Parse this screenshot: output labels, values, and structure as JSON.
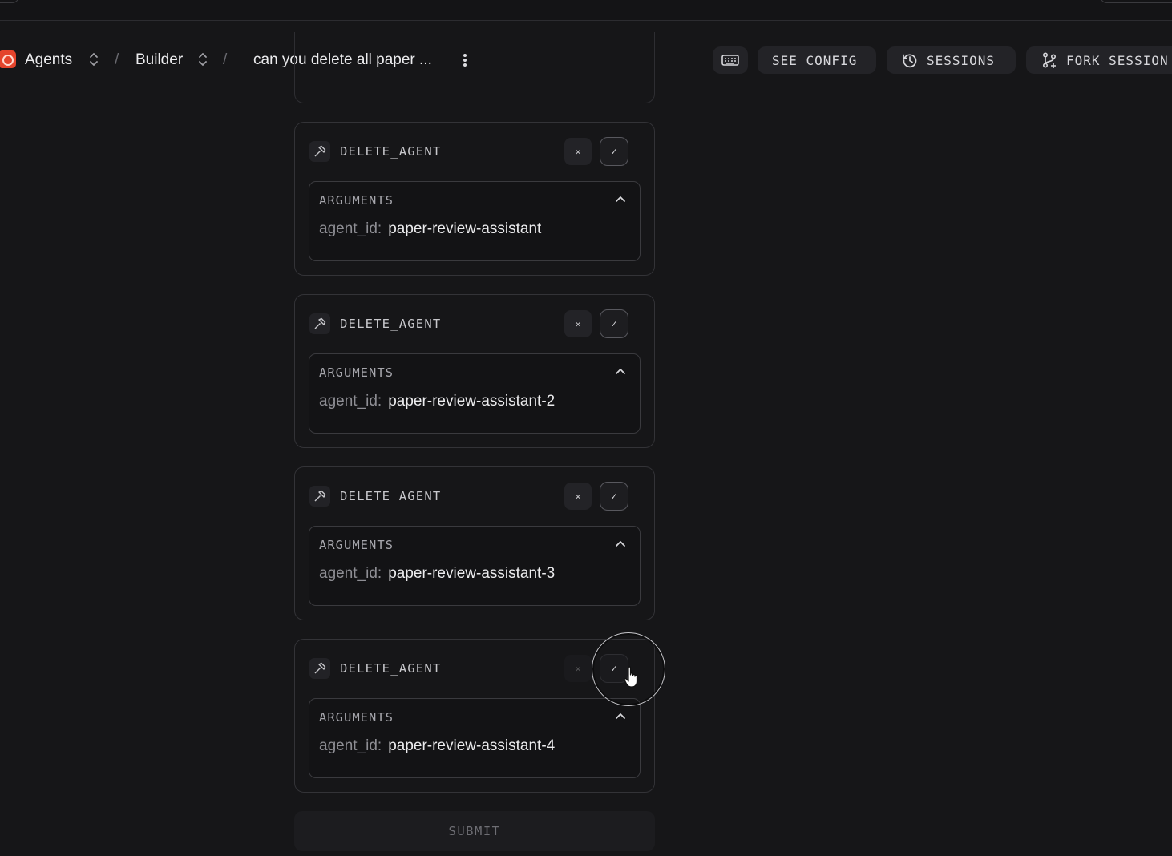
{
  "header": {
    "breadcrumb": [
      {
        "label": "Agents"
      },
      {
        "label": "Builder"
      },
      {
        "label": "can you delete all paper ..."
      }
    ],
    "separator": "/",
    "buttons": {
      "keyboard_icon": "keyboard-icon",
      "see_config": "SEE CONFIG",
      "sessions": "SESSIONS",
      "fork_session": "FORK SESSION"
    }
  },
  "tool_calls": [
    {
      "tool": "DELETE_AGENT",
      "args_title": "ARGUMENTS",
      "arg_key": "agent_id:",
      "arg_value": "paper-review-assistant"
    },
    {
      "tool": "DELETE_AGENT",
      "args_title": "ARGUMENTS",
      "arg_key": "agent_id:",
      "arg_value": "paper-review-assistant-2"
    },
    {
      "tool": "DELETE_AGENT",
      "args_title": "ARGUMENTS",
      "arg_key": "agent_id:",
      "arg_value": "paper-review-assistant-3"
    },
    {
      "tool": "DELETE_AGENT",
      "args_title": "ARGUMENTS",
      "arg_key": "agent_id:",
      "arg_value": "paper-review-assistant-4"
    }
  ],
  "actions": {
    "reject_symbol": "×",
    "approve_symbol": "✓"
  },
  "submit_label": "SUBMIT",
  "colors": {
    "brand": "#e4442c",
    "background": "#161618"
  }
}
